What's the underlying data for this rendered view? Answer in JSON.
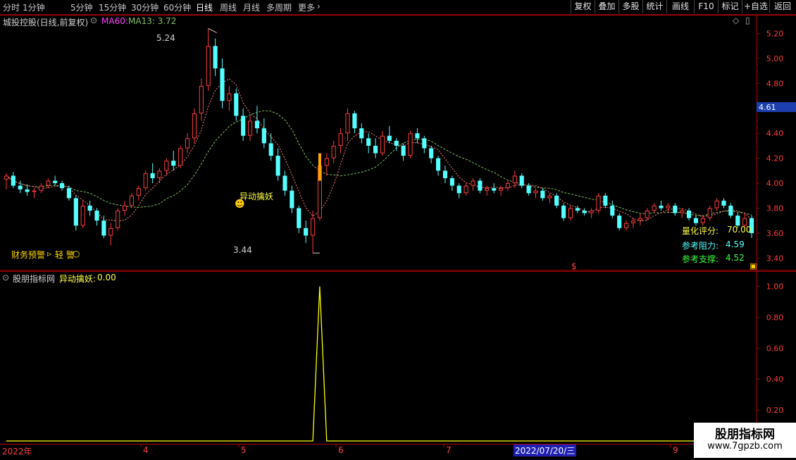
{
  "toolbar": {
    "timeframes": [
      "分时",
      "1分钟",
      "5分钟",
      "15分钟",
      "30分钟",
      "60分钟",
      "日线",
      "周线",
      "月线",
      "多周期",
      "更多"
    ],
    "active": "日线",
    "right_buttons": [
      "复权",
      "叠加",
      "多股",
      "统计",
      "画线",
      "F10",
      "标记",
      "+自选",
      "返回"
    ]
  },
  "main": {
    "stock_title": "城投控股(日线,前复权)",
    "ma60_label": "MA60:",
    "ma13_label": "MA13: 3.72",
    "high_label": "5.24",
    "low_label": "3.44",
    "signal_label": "异动擒妖",
    "finance_warning": "财务预警",
    "finance_level": "轻 警",
    "s_marker": "$",
    "current_price": "4.61",
    "score_label": "量化评分:",
    "score_value": "70.00",
    "resistance_label": "参考阻力:",
    "resistance_value": "4.59",
    "support_label": "参考支撑:",
    "support_value": "4.52",
    "y_ticks": [
      "5.20",
      "5.00",
      "4.80",
      "4.60",
      "4.40",
      "4.20",
      "4.00",
      "3.80",
      "3.60",
      "3.40"
    ]
  },
  "sub": {
    "indicator_name": "股朋指标网",
    "signal_name": "异动擒妖:",
    "signal_value": "0.00",
    "y_ticks": [
      "1.00",
      "0.80",
      "0.60",
      "0.40",
      "0.20"
    ]
  },
  "xaxis": {
    "labels": [
      "2022年",
      "4",
      "5",
      "6",
      "7",
      "9"
    ],
    "cursor_date": "2022/07/20/三"
  },
  "watermark": {
    "title": "股朋指标网",
    "url": "www.7gpzb.com"
  },
  "colors": {
    "up": "#ff3c3c",
    "down": "#54ffff",
    "ma13": "#ff8080",
    "ma60": "#80c060",
    "signal": "#ffff00",
    "axis": "#b00000"
  },
  "chart_data": {
    "type": "candlestick",
    "price_range": [
      3.3,
      5.35
    ],
    "ohlc": [
      [
        4.03,
        4.08,
        3.95,
        4.06
      ],
      [
        4.06,
        4.09,
        3.96,
        3.98
      ],
      [
        3.98,
        4.02,
        3.92,
        3.95
      ],
      [
        3.95,
        3.99,
        3.9,
        3.93
      ],
      [
        3.93,
        3.96,
        3.88,
        3.94
      ],
      [
        3.94,
        4.0,
        3.92,
        3.98
      ],
      [
        3.98,
        4.04,
        3.96,
        4.02
      ],
      [
        4.02,
        4.06,
        3.98,
        4.0
      ],
      [
        4.0,
        4.02,
        3.94,
        3.96
      ],
      [
        3.96,
        3.98,
        3.86,
        3.88
      ],
      [
        3.88,
        3.9,
        3.62,
        3.66
      ],
      [
        3.66,
        3.86,
        3.64,
        3.82
      ],
      [
        3.82,
        3.86,
        3.74,
        3.78
      ],
      [
        3.78,
        3.8,
        3.66,
        3.7
      ],
      [
        3.7,
        3.74,
        3.56,
        3.58
      ],
      [
        3.58,
        3.68,
        3.5,
        3.64
      ],
      [
        3.64,
        3.8,
        3.62,
        3.78
      ],
      [
        3.78,
        3.86,
        3.74,
        3.82
      ],
      [
        3.82,
        3.92,
        3.8,
        3.9
      ],
      [
        3.9,
        3.98,
        3.86,
        3.96
      ],
      [
        3.96,
        4.1,
        3.94,
        4.08
      ],
      [
        4.08,
        4.16,
        4.0,
        4.04
      ],
      [
        4.04,
        4.12,
        4.0,
        4.1
      ],
      [
        4.1,
        4.2,
        4.06,
        4.18
      ],
      [
        4.18,
        4.26,
        4.1,
        4.14
      ],
      [
        4.14,
        4.3,
        4.12,
        4.28
      ],
      [
        4.28,
        4.4,
        4.24,
        4.36
      ],
      [
        4.36,
        4.6,
        4.32,
        4.56
      ],
      [
        4.56,
        4.84,
        4.5,
        4.78
      ],
      [
        4.78,
        5.24,
        4.74,
        5.1
      ],
      [
        5.1,
        5.16,
        4.86,
        4.92
      ],
      [
        4.92,
        5.0,
        4.6,
        4.66
      ],
      [
        4.66,
        4.78,
        4.58,
        4.72
      ],
      [
        4.72,
        4.76,
        4.5,
        4.54
      ],
      [
        4.54,
        4.6,
        4.34,
        4.38
      ],
      [
        4.38,
        4.54,
        4.34,
        4.5
      ],
      [
        4.5,
        4.62,
        4.4,
        4.44
      ],
      [
        4.44,
        4.52,
        4.28,
        4.32
      ],
      [
        4.32,
        4.4,
        4.18,
        4.22
      ],
      [
        4.22,
        4.28,
        4.02,
        4.06
      ],
      [
        4.06,
        4.1,
        3.9,
        3.94
      ],
      [
        3.94,
        3.98,
        3.76,
        3.8
      ],
      [
        3.8,
        3.82,
        3.6,
        3.64
      ],
      [
        3.64,
        3.7,
        3.52,
        3.58
      ],
      [
        3.58,
        3.78,
        3.44,
        3.72
      ],
      [
        3.72,
        4.16,
        3.7,
        4.14
      ],
      [
        4.14,
        4.24,
        4.06,
        4.2
      ],
      [
        4.2,
        4.34,
        4.16,
        4.3
      ],
      [
        4.3,
        4.44,
        4.24,
        4.4
      ],
      [
        4.4,
        4.6,
        4.34,
        4.56
      ],
      [
        4.56,
        4.58,
        4.4,
        4.44
      ],
      [
        4.44,
        4.48,
        4.32,
        4.36
      ],
      [
        4.36,
        4.4,
        4.24,
        4.3
      ],
      [
        4.3,
        4.36,
        4.2,
        4.24
      ],
      [
        4.24,
        4.42,
        4.22,
        4.38
      ],
      [
        4.38,
        4.46,
        4.32,
        4.34
      ],
      [
        4.34,
        4.36,
        4.26,
        4.3
      ],
      [
        4.3,
        4.32,
        4.18,
        4.22
      ],
      [
        4.22,
        4.42,
        4.2,
        4.4
      ],
      [
        4.4,
        4.44,
        4.32,
        4.36
      ],
      [
        4.36,
        4.38,
        4.24,
        4.28
      ],
      [
        4.28,
        4.3,
        4.16,
        4.2
      ],
      [
        4.2,
        4.22,
        4.06,
        4.1
      ],
      [
        4.1,
        4.14,
        4.0,
        4.04
      ],
      [
        4.04,
        4.06,
        3.94,
        3.98
      ],
      [
        3.98,
        4.0,
        3.88,
        3.92
      ],
      [
        3.92,
        4.0,
        3.9,
        3.98
      ],
      [
        3.98,
        4.04,
        3.94,
        4.02
      ],
      [
        4.02,
        4.04,
        3.92,
        3.94
      ],
      [
        3.94,
        3.98,
        3.9,
        3.96
      ],
      [
        3.96,
        4.0,
        3.92,
        3.94
      ],
      [
        3.94,
        3.98,
        3.9,
        3.96
      ],
      [
        3.96,
        4.02,
        3.94,
        4.0
      ],
      [
        4.0,
        4.1,
        3.96,
        4.06
      ],
      [
        4.06,
        4.08,
        3.96,
        3.98
      ],
      [
        3.98,
        4.0,
        3.9,
        3.92
      ],
      [
        3.92,
        3.96,
        3.88,
        3.94
      ],
      [
        3.94,
        3.96,
        3.86,
        3.88
      ],
      [
        3.88,
        3.92,
        3.84,
        3.9
      ],
      [
        3.9,
        3.92,
        3.8,
        3.82
      ],
      [
        3.82,
        3.84,
        3.7,
        3.72
      ],
      [
        3.72,
        3.82,
        3.7,
        3.8
      ],
      [
        3.8,
        3.82,
        3.76,
        3.78
      ],
      [
        3.78,
        3.8,
        3.74,
        3.76
      ],
      [
        3.76,
        3.8,
        3.72,
        3.78
      ],
      [
        3.78,
        3.92,
        3.76,
        3.9
      ],
      [
        3.9,
        3.92,
        3.8,
        3.82
      ],
      [
        3.82,
        3.86,
        3.72,
        3.74
      ],
      [
        3.74,
        3.76,
        3.62,
        3.64
      ],
      [
        3.64,
        3.7,
        3.62,
        3.68
      ],
      [
        3.68,
        3.72,
        3.64,
        3.7
      ],
      [
        3.7,
        3.76,
        3.66,
        3.72
      ],
      [
        3.72,
        3.8,
        3.7,
        3.78
      ],
      [
        3.78,
        3.84,
        3.76,
        3.82
      ],
      [
        3.82,
        3.86,
        3.78,
        3.8
      ],
      [
        3.8,
        3.84,
        3.76,
        3.82
      ],
      [
        3.82,
        3.84,
        3.74,
        3.76
      ],
      [
        3.76,
        3.8,
        3.72,
        3.78
      ],
      [
        3.78,
        3.8,
        3.7,
        3.72
      ],
      [
        3.72,
        3.74,
        3.66,
        3.68
      ],
      [
        3.68,
        3.74,
        3.66,
        3.72
      ],
      [
        3.72,
        3.82,
        3.7,
        3.8
      ],
      [
        3.8,
        3.88,
        3.78,
        3.86
      ],
      [
        3.86,
        3.88,
        3.8,
        3.82
      ],
      [
        3.82,
        3.84,
        3.72,
        3.74
      ],
      [
        3.74,
        3.76,
        3.64,
        3.66
      ],
      [
        3.66,
        3.76,
        3.64,
        3.72
      ],
      [
        3.72,
        3.74,
        3.56,
        3.6
      ]
    ],
    "sub_signal": {
      "name": "异动擒妖",
      "spike_bar": 45,
      "spike_value": 1.0,
      "range": [
        0,
        1.08
      ]
    }
  }
}
